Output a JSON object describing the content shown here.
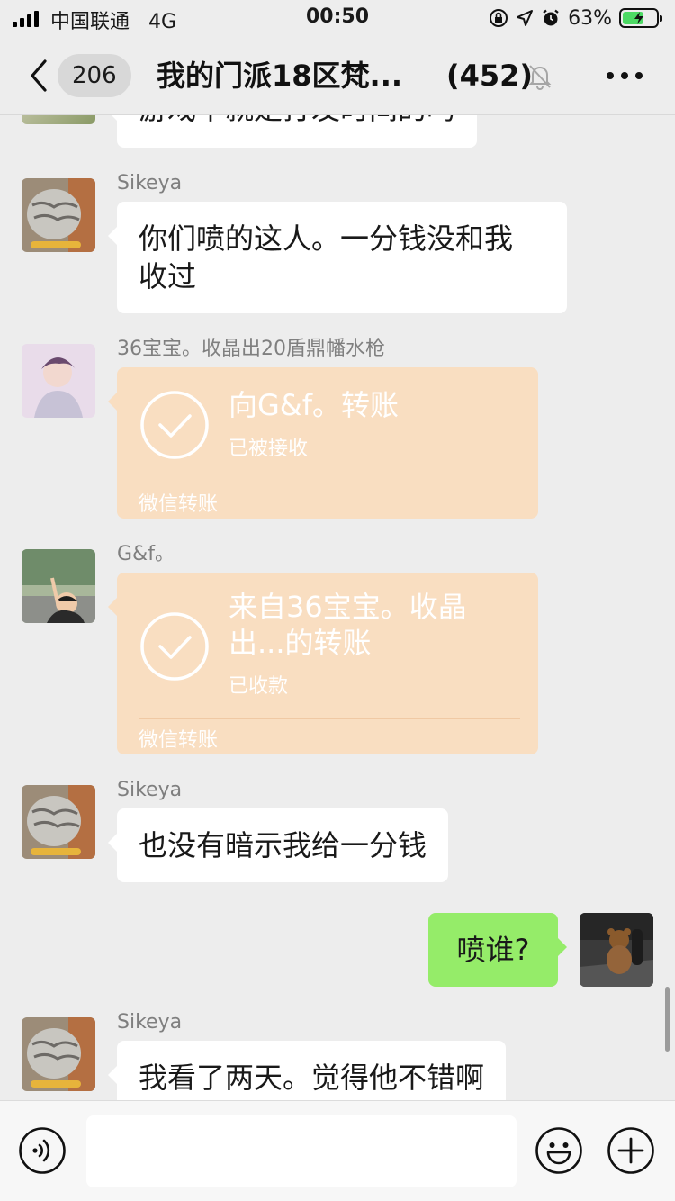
{
  "status_bar": {
    "carrier": "中国联通",
    "network": "4G",
    "time": "00:50",
    "battery_percent": "63%",
    "battery_level": 0.63,
    "icons": [
      "signal-icon",
      "orientation-lock-icon",
      "location-icon",
      "alarm-icon",
      "battery-charging-icon"
    ]
  },
  "nav": {
    "back_badge": "206",
    "title": "我的门派18区梵...",
    "member_count": "(452)",
    "icons": [
      "back-chevron-icon",
      "mute-bell-icon",
      "more-dots-icon"
    ]
  },
  "messages": {
    "partial_top_text": "游戏不就是打发时间的吗",
    "m1": {
      "sender": "Sikeya",
      "text_line1": "你们喷的这人。一分钱没和我",
      "text_line2": "收过"
    },
    "m2": {
      "sender": "36宝宝。收晶出20盾鼎幡水枪",
      "transfer_title": "向G&f。转账",
      "transfer_status": "已被接收",
      "transfer_footer": "微信转账"
    },
    "m3": {
      "sender": "G&f。",
      "transfer_title_line1": "来自36宝宝。收晶",
      "transfer_title_line2": "出...的转账",
      "transfer_status": "已收款",
      "transfer_footer": "微信转账"
    },
    "m4": {
      "sender": "Sikeya",
      "text": "也没有暗示我给一分钱"
    },
    "m5": {
      "sender": "me",
      "text": "喷谁?"
    },
    "m6": {
      "sender": "Sikeya",
      "text": "我看了两天。觉得他不错啊"
    }
  },
  "input_bar": {
    "icons": [
      "voice-icon",
      "emoji-icon",
      "plus-icon"
    ],
    "input_value": ""
  },
  "colors": {
    "background": "#ededed",
    "my_bubble": "#95ec69",
    "transfer_card": "#f9dec1",
    "battery_green": "#4cd964"
  }
}
